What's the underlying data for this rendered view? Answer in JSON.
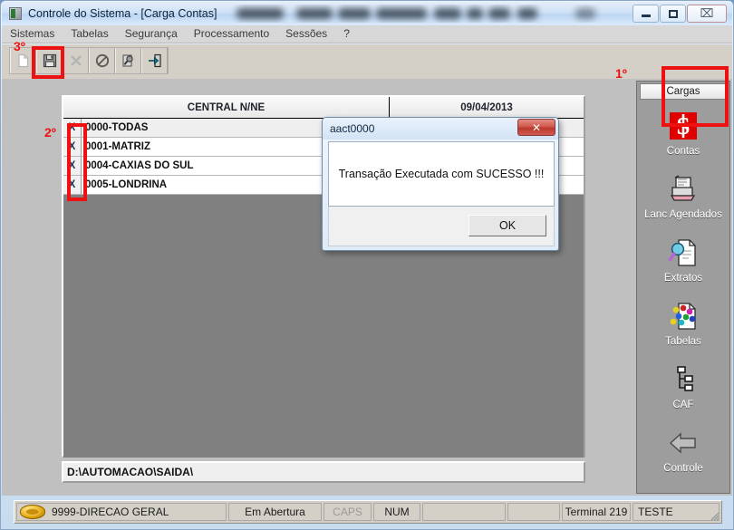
{
  "window": {
    "title": "Controle do Sistema - [Carga Contas]",
    "title_icon": "app-window-icon",
    "blurred_region": "redacted-title-text",
    "buttons": {
      "minimize": "minimize-icon",
      "maximize": "maximize-icon",
      "close": "close-icon",
      "close_glyph": "⌧"
    }
  },
  "menubar": {
    "items": [
      {
        "label": "Sistemas"
      },
      {
        "label": "Tabelas"
      },
      {
        "label": "Segurança"
      },
      {
        "label": "Processamento"
      },
      {
        "label": "Sessões"
      },
      {
        "label": "?"
      }
    ]
  },
  "toolbar": {
    "buttons": [
      {
        "name": "new-document-button",
        "icon": "new-document-icon",
        "enabled": false
      },
      {
        "name": "save-button",
        "icon": "floppy-disk-icon",
        "enabled": true
      },
      {
        "name": "delete-button",
        "icon": "x-cross-icon",
        "enabled": false
      },
      {
        "name": "cancel-button",
        "icon": "prohibited-circle-icon",
        "enabled": true
      },
      {
        "name": "query-button",
        "icon": "key-magnifier-icon",
        "enabled": true
      },
      {
        "name": "exit-button",
        "icon": "exit-door-icon",
        "enabled": true
      }
    ]
  },
  "grid": {
    "columns": [
      {
        "label": "CENTRAL N/NE"
      },
      {
        "label": "09/04/2013"
      }
    ],
    "rows": [
      {
        "mark": "X",
        "name": "0000-TODAS",
        "selected": true
      },
      {
        "mark": "X",
        "name": "0001-MATRIZ",
        "selected": false
      },
      {
        "mark": "X",
        "name": "0004-CAXIAS DO SUL",
        "selected": false
      },
      {
        "mark": "X",
        "name": "0005-LONDRINA",
        "selected": false
      }
    ]
  },
  "path_field": {
    "value": "D:\\AUTOMACAO\\SAIDA\\",
    "placeholder": "D:\\"
  },
  "sidebar": {
    "header": "Cargas",
    "items": [
      {
        "label": "Contas",
        "icon": "money-s-icon",
        "selected": true
      },
      {
        "label": "Lanc Agendados",
        "icon": "printer-document-icon",
        "selected": false
      },
      {
        "label": "Extratos",
        "icon": "magnifier-document-icon",
        "selected": false
      },
      {
        "label": "Tabelas",
        "icon": "colored-nodes-document-icon",
        "selected": false
      },
      {
        "label": "CAF",
        "icon": "tree-hierarchy-icon",
        "selected": false
      },
      {
        "label": "Controle",
        "icon": "back-arrow-icon",
        "selected": false
      }
    ]
  },
  "statusbar": {
    "coin_icon": "gold-coin-icon",
    "user": "9999-DIRECAO GERAL",
    "state": "Em Abertura",
    "caps": "CAPS",
    "num": "NUM",
    "empty1": "",
    "empty2": "",
    "terminal": "Terminal 219",
    "environment": "TESTE",
    "resize_grip": "resize-grip-icon"
  },
  "dialog": {
    "title": "aact0000",
    "message": "Transação Executada com SUCESSO !!!",
    "ok_label": "OK",
    "close_glyph": "✕"
  },
  "annotations": {
    "step1": "1º",
    "step2": "2º",
    "step3": "3º",
    "color": "#ee1111"
  }
}
